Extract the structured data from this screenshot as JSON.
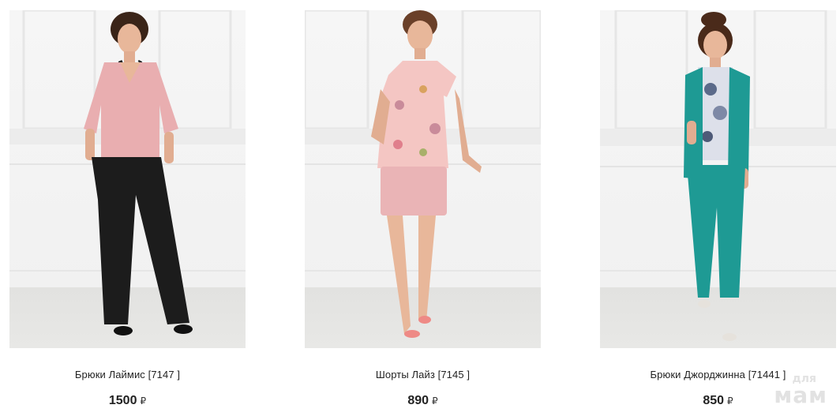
{
  "products": [
    {
      "title": "Брюки Лаймис [7147 ]",
      "price": "1500",
      "currency": "₽",
      "photo": "model-pink-blouse-black-trousers"
    },
    {
      "title": "Шорты Лайз [7145 ]",
      "price": "890",
      "currency": "₽",
      "photo": "model-floral-top-pink-shorts"
    },
    {
      "title": "Брюки Джорджинна [71441 ]",
      "price": "850",
      "currency": "₽",
      "photo": "model-teal-vest-teal-trousers"
    }
  ],
  "watermark": {
    "line1": "для",
    "line2": "мам"
  },
  "colors": {
    "text": "#222222",
    "photo_background": "#f2f2f2",
    "blouse_pink": "#e9aeb0",
    "trousers_black": "#1c1c1c",
    "shorts_pink": "#eab4b6",
    "suit_teal": "#1e9a94"
  }
}
